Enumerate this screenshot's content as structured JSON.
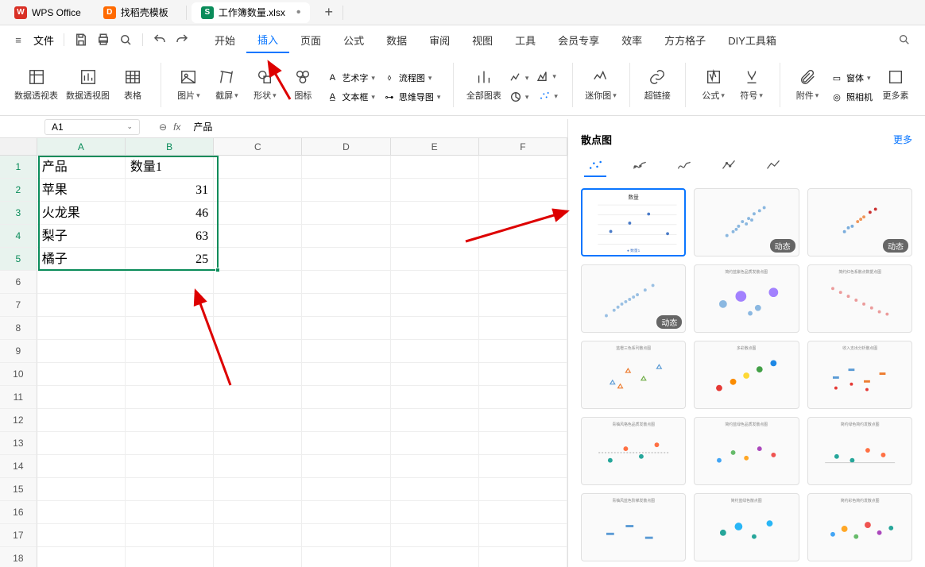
{
  "tabs": {
    "wps": "WPS Office",
    "template": "找稻壳模板",
    "workbook": "工作簿数量.xlsx",
    "add": "+"
  },
  "menu": {
    "file": "文件",
    "items": [
      "开始",
      "插入",
      "页面",
      "公式",
      "数据",
      "审阅",
      "视图",
      "工具",
      "会员专享",
      "效率",
      "方方格子",
      "DIY工具箱"
    ],
    "active_index": 1
  },
  "ribbon": {
    "pivot_table": "数据透视表",
    "pivot_chart": "数据透视图",
    "table": "表格",
    "picture": "图片",
    "screenshot": "截屏",
    "shape": "形状",
    "icon": "图标",
    "wordart": "艺术字",
    "textbox": "文本框",
    "flowchart": "流程图",
    "mindmap": "思维导图",
    "allcharts": "全部图表",
    "sparkline": "迷你图",
    "hyperlink": "超链接",
    "formula": "公式",
    "symbol": "符号",
    "attach": "附件",
    "camera": "照相机",
    "window": "窗体",
    "more": "更多素"
  },
  "formula_bar": {
    "cell_ref": "A1",
    "fx": "fx",
    "value": "产品"
  },
  "columns": [
    "A",
    "B",
    "C",
    "D",
    "E",
    "F"
  ],
  "sheet": {
    "headers": [
      "产品",
      "数量1"
    ],
    "rows": [
      {
        "a": "苹果",
        "b": "31"
      },
      {
        "a": "火龙果",
        "b": "46"
      },
      {
        "a": "梨子",
        "b": "63"
      },
      {
        "a": "橘子",
        "b": "25"
      }
    ]
  },
  "panel": {
    "title": "散点图",
    "more": "更多",
    "badge_dynamic": "动态"
  },
  "chart_data": {
    "type": "scatter",
    "title": "数量",
    "categories": [
      "苹果",
      "火龙果",
      "梨子",
      "橘子"
    ],
    "series": [
      {
        "name": "数量1",
        "values": [
          31,
          46,
          63,
          25
        ]
      }
    ],
    "ylim": [
      0,
      70
    ]
  }
}
